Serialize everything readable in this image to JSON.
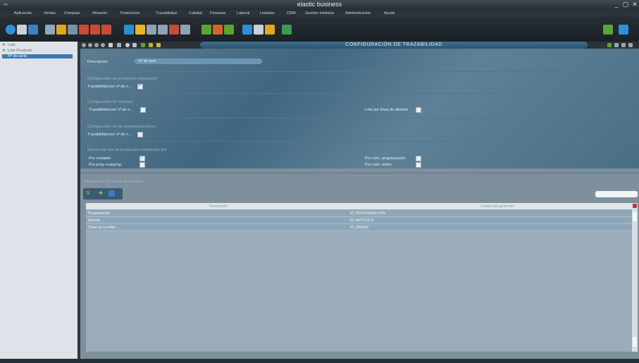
{
  "window": {
    "title": "elastic business"
  },
  "menu": [
    "Aplicación",
    "Ventas",
    "Compras",
    "Almacén",
    "Producción",
    "Trazabilidad",
    "Calidad",
    "Finanzas",
    "Laboral",
    "Listados",
    "CRM",
    "Gestión módulos",
    "Administración",
    "Ayuda"
  ],
  "sidebar": {
    "items": [
      {
        "label": "Lote"
      },
      {
        "label": "Lote Producto"
      },
      {
        "label": "Nº de serie"
      }
    ]
  },
  "header": {
    "title": "CONFIGURACIÓN DE TRAZABILIDAD"
  },
  "form": {
    "descripcion_label": "Descripción",
    "descripcion_value": "Nº de serie",
    "sec1_title": "Configuración de producción (Impulsión)",
    "sec1_field": "Trazabilidad por nº de s...",
    "sec2_title": "Configuración de compras",
    "sec2_field": "Trazabilidad por nº de s...",
    "sec2_right": "Lote por línea de albarán",
    "sec3_title": "Configuración de los movimientos libres",
    "sec3_field": "Trazabilidad por nº de s...",
    "sec4_title": "Número de lote de producción establecido por",
    "opt_contador": "Por contador",
    "opt_progsubprog": "Por prog.+subprog.",
    "opt_numprog": "Por núm. programación",
    "opt_numorden": "Por núm. orden",
    "sec5_title": "Parámetros de lote de producción"
  },
  "grid": {
    "columns": [
      "Descripción",
      "Campo del parámetro"
    ],
    "rows": [
      {
        "desc": "Programación",
        "campo": "ID_PROGRAMACION"
      },
      {
        "desc": "Artículo",
        "campo": "ID_ARTICULO"
      },
      {
        "desc": "Clave de la orden",
        "campo": "ID_ORDEN"
      }
    ]
  }
}
